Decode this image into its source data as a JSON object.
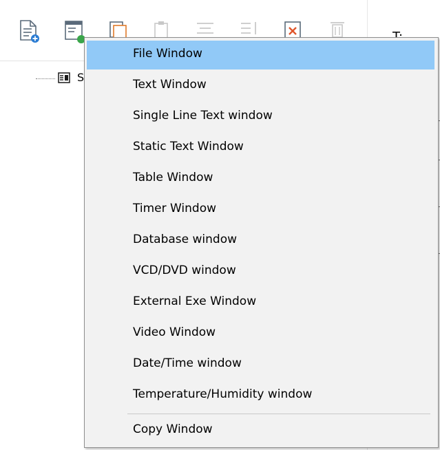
{
  "tree": {
    "node_label": "S"
  },
  "right_panel": {
    "header_text": "T:"
  },
  "toolbar": {
    "buttons": [
      {
        "name": "add-file-icon"
      },
      {
        "name": "add-window-icon"
      },
      {
        "name": "copy-icon"
      },
      {
        "name": "paste-icon"
      },
      {
        "name": "align-top-icon"
      },
      {
        "name": "move-down-icon"
      },
      {
        "name": "delete-icon"
      },
      {
        "name": "trash-icon"
      }
    ]
  },
  "menu": {
    "items": [
      {
        "label": "File Window"
      },
      {
        "label": "Text Window"
      },
      {
        "label": "Single Line Text window"
      },
      {
        "label": "Static Text Window"
      },
      {
        "label": "Table Window"
      },
      {
        "label": "Timer Window"
      },
      {
        "label": "Database window"
      },
      {
        "label": "VCD/DVD window"
      },
      {
        "label": "External Exe Window"
      },
      {
        "label": "Video Window"
      },
      {
        "label": "Date/Time window"
      },
      {
        "label": "Temperature/Humidity window"
      },
      {
        "label": "Copy Window"
      }
    ],
    "highlight_color": "#91c9f7"
  }
}
